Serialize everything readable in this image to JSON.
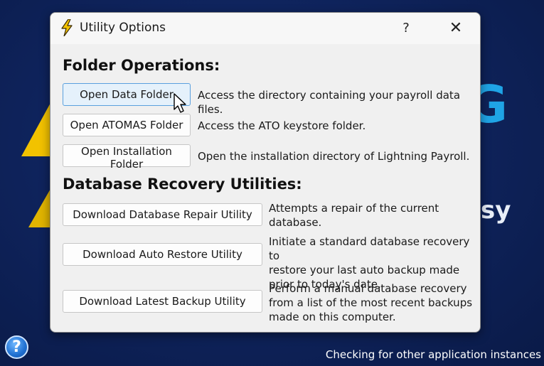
{
  "dialog": {
    "title": "Utility Options",
    "help_label": "?",
    "close_label": "✕",
    "icon": "lightning-bolt-icon"
  },
  "folder_operations": {
    "heading": "Folder Operations:",
    "items": [
      {
        "button": "Open Data Folder",
        "description": "Access the directory containing your payroll data files."
      },
      {
        "button": "Open ATOMAS Folder",
        "description": "Access the ATO keystore folder."
      },
      {
        "button": "Open Installation Folder",
        "description": "Open the installation directory of Lightning Payroll."
      }
    ]
  },
  "database_recovery": {
    "heading": "Database Recovery Utilities:",
    "items": [
      {
        "button": "Download Database Repair Utility",
        "description_lines": [
          "Attempts a repair of the current",
          "database."
        ]
      },
      {
        "button": "Download Auto Restore Utility",
        "description_lines": [
          "Initiate a standard database recovery to",
          "restore your last auto backup made",
          "prior to today's date."
        ]
      },
      {
        "button": "Download Latest Backup Utility",
        "description_lines": [
          "Perform a manual database recovery",
          "from a list of the most recent backups",
          "made on this computer."
        ]
      }
    ]
  },
  "background": {
    "help_label": "?",
    "status": "Checking for other application instances",
    "letter_g": "G",
    "letters_sy": "sy"
  },
  "colors": {
    "desktop_bg": "#0f245e",
    "focused_button_border": "#5aa0de",
    "focused_button_bg": "#e5f1fb",
    "warning_yellow": "#f2c200",
    "accent_blue": "#1fa4e6"
  }
}
